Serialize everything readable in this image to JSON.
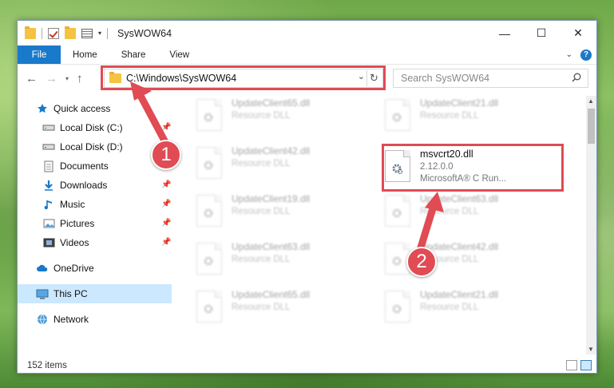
{
  "window": {
    "title": "SysWOW64",
    "minimize": "—",
    "maximize": "☐",
    "close": "✕"
  },
  "ribbon": {
    "tabs": [
      "File",
      "Home",
      "Share",
      "View"
    ],
    "expand": "⌄",
    "help": "?"
  },
  "navigation": {
    "back": "←",
    "forward": "→",
    "recent": "▾",
    "up": "↑"
  },
  "address_bar": {
    "path": "C:\\Windows\\SysWOW64",
    "dropdown": "⌄",
    "refresh": "↻"
  },
  "search": {
    "placeholder": "Search SysWOW64"
  },
  "sidebar": {
    "items": [
      {
        "label": "Quick access",
        "icon": "star-icon"
      },
      {
        "label": "Local Disk (C:)",
        "icon": "drive-icon",
        "pinned": true
      },
      {
        "label": "Local Disk (D:)",
        "icon": "drive-icon"
      },
      {
        "label": "Documents",
        "icon": "documents-icon"
      },
      {
        "label": "Downloads",
        "icon": "download-icon",
        "pinned": true
      },
      {
        "label": "Music",
        "icon": "music-icon",
        "pinned": true
      },
      {
        "label": "Pictures",
        "icon": "pictures-icon",
        "pinned": true
      },
      {
        "label": "Videos",
        "icon": "videos-icon",
        "pinned": true
      },
      {
        "label": "OneDrive",
        "icon": "cloud-icon"
      },
      {
        "label": "This PC",
        "icon": "computer-icon",
        "selected": true
      },
      {
        "label": "Network",
        "icon": "network-icon"
      }
    ]
  },
  "files": [
    {
      "name": "UpdateClient65.dll",
      "meta": "Resource DLL",
      "blurred": true
    },
    {
      "name": "UpdateClient21.dll",
      "meta": "Resource DLL",
      "blurred": true
    },
    {
      "name": "UpdateClient42.dll",
      "meta": "Resource DLL",
      "blurred": true
    },
    {
      "name": "msvcrt20.dll",
      "version": "2.12.0.0",
      "meta": "MicrosoftA® C Run...",
      "blurred": false
    },
    {
      "name": "UpdateClient19.dll",
      "meta": "Resource DLL",
      "blurred": true
    },
    {
      "name": "UpdateClient63.dll",
      "meta": "Resource DLL",
      "blurred": true
    },
    {
      "name": "UpdateClient63.dll",
      "meta": "Resource DLL",
      "blurred": true
    },
    {
      "name": "UpdateClient42.dll",
      "meta": "Resource DLL",
      "blurred": true
    },
    {
      "name": "UpdateClient65.dll",
      "meta": "Resource DLL",
      "blurred": true
    },
    {
      "name": "UpdateClient21.dll",
      "meta": "Resource DLL",
      "blurred": true
    }
  ],
  "status": {
    "count": "152 items"
  },
  "annotations": {
    "step1": "1",
    "step2": "2"
  },
  "colors": {
    "accent": "#1979ca",
    "highlight": "#e04b54",
    "selection": "#cce8ff"
  }
}
